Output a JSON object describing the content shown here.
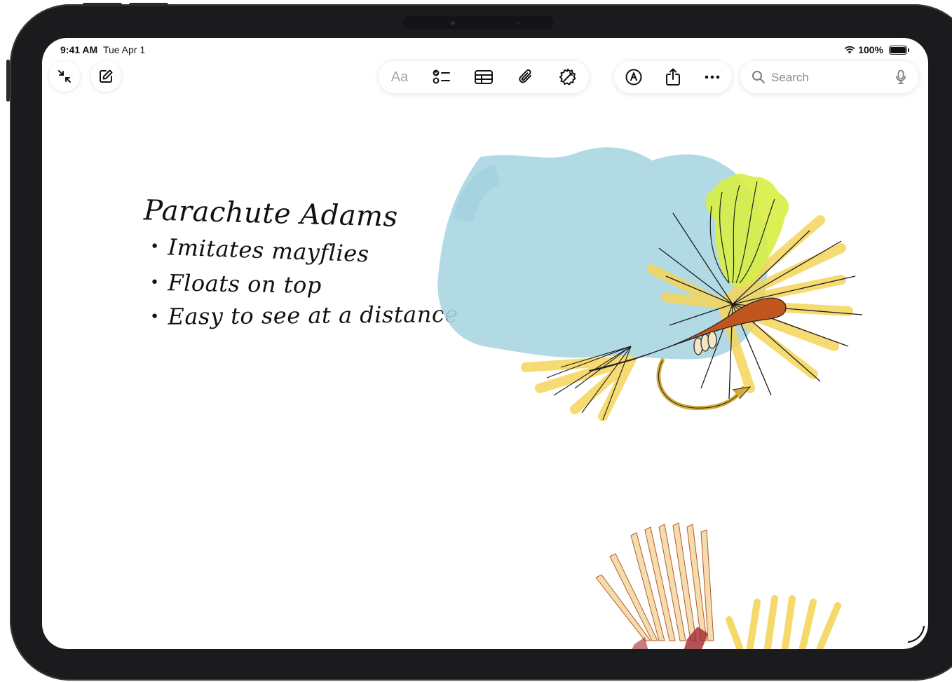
{
  "status_bar": {
    "time": "9:41 AM",
    "date": "Tue Apr 1",
    "battery": "100%"
  },
  "toolbar": {
    "left": [
      {
        "icon": "collapse-arrows-icon",
        "name": "minimize-button"
      },
      {
        "icon": "compose-icon",
        "name": "new-note-button"
      }
    ],
    "format_label": "Aa",
    "format_tools": [
      {
        "icon": "checklist-icon"
      },
      {
        "icon": "table-icon"
      },
      {
        "icon": "paperclip-icon"
      },
      {
        "icon": "image-wand-icon"
      }
    ],
    "actions": [
      {
        "icon": "markup-pen-icon"
      },
      {
        "icon": "share-icon"
      },
      {
        "icon": "more-icon"
      }
    ],
    "search_placeholder": "Search"
  },
  "note": {
    "title": "Parachute Adams",
    "bullets": [
      "Imitates mayflies",
      "Floats on top",
      "Easy to see at a distance"
    ]
  },
  "colors": {
    "sky_blue": "#a9d6e2",
    "yellow": "#f5d55a",
    "lime": "#d8ee44",
    "rust": "#c0561e",
    "hook_gold": "#d3ad3c"
  }
}
